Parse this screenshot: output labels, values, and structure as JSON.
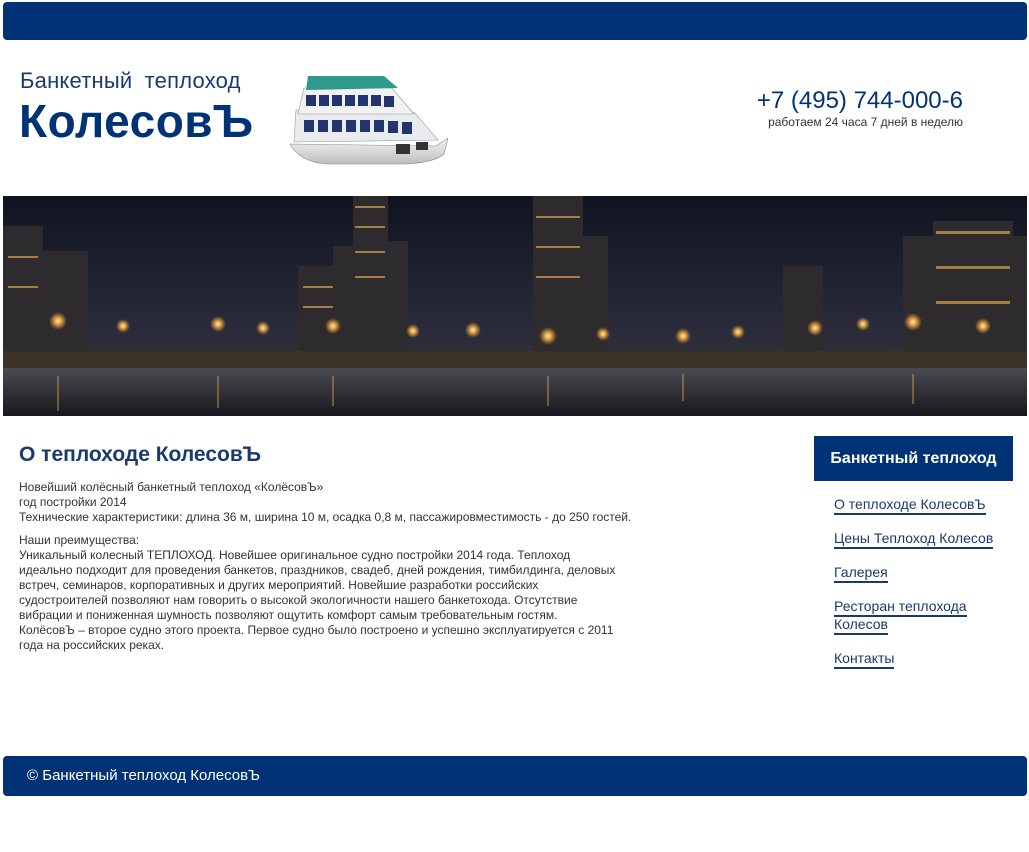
{
  "header": {
    "brand_small": "Банкетный теплоход",
    "brand_big": "КолесовЪ",
    "phone": "+7 (495) 744-000-6",
    "hours": "работаем 24 часа 7 дней в неделю"
  },
  "main": {
    "title": "О теплоходе КолесовЪ",
    "paragraphs": [
      "Новейший колёсный банкетный теплоход «КолёсовЪ»",
      "год постройки 2014",
      "Технические характеристики: длина 36 м, ширина 10 м, осадка 0,8 м, пассажировместимость - до 250 гостей.",
      "Наши преимущества:",
      "Уникальный колесный ТЕПЛОХОД. Новейшее оригинальное судно постройки 2014 года. Теплоход идеально подходит для проведения банкетов, праздников, свадеб, дней рождения, тимбилдинга, деловых встреч, семинаров, корпоративных и других мероприятий. Новейшие разработки российских судостроителей позволяют нам говорить о высокой экологичности нашего банкетохода. Отсутствие вибрации и пониженная шумность позволяют ощутить комфорт самым требовательным гостям.",
      "КолёсовЪ – второе судно этого проекта. Первое судно было построено и успешно эксплуатируется с 2011 года на российских реках."
    ]
  },
  "sidebar": {
    "heading": "Банкетный теплоход",
    "items": [
      {
        "label": "О теплоходе КолесовЪ"
      },
      {
        "label": "Цены Теплоход Колесов"
      },
      {
        "label": "Галерея"
      },
      {
        "label": "Ресторан теплохода Колесов"
      },
      {
        "label": "Контакты"
      }
    ]
  },
  "footer": {
    "text": "© Банкетный теплоход КолесовЪ"
  },
  "colors": {
    "primary": "#003375",
    "text": "#333333"
  }
}
